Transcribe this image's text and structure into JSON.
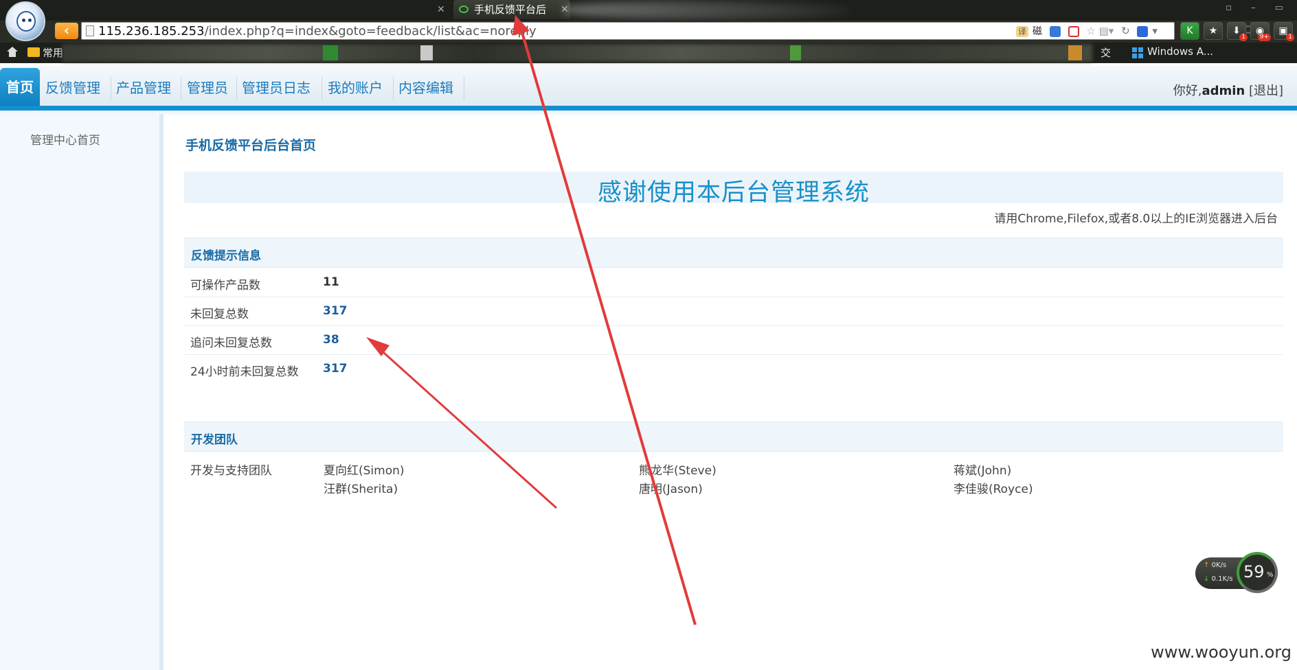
{
  "browser": {
    "tab_title": "手机反馈平台后",
    "url_host": "115.236.185.253",
    "url_path": "/index.php?q=index&goto=feedback/list&ac=noreply",
    "url_tools": [
      "译",
      "磁"
    ],
    "toolbar_badges": [
      "1",
      "9+",
      "1"
    ],
    "window_controls": "▫ – ▭",
    "bookmarks": {
      "common_folder": "常用",
      "jiao": "交",
      "windows": "Windows A..."
    },
    "colors": {
      "accent": "#f08a10",
      "chrome": "#1c1f1a"
    }
  },
  "nav": {
    "items": [
      "首页",
      "反馈管理",
      "产品管理",
      "管理员",
      "管理员日志",
      "我的账户",
      "内容编辑"
    ],
    "greeting_prefix": "你好,",
    "username": "admin",
    "logout": "[退出]",
    "colors": {
      "accent": "#1290cf",
      "link": "#1a7cbf"
    }
  },
  "sidebar": {
    "items": [
      "管理中心首页"
    ]
  },
  "main": {
    "page_title": "手机反馈平台后台首页",
    "banner_title": "感谢使用本后台管理系统",
    "browser_note": "请用Chrome,Filefox,或者8.0以上的IE浏览器进入后台",
    "feedback_section": {
      "title": "反馈提示信息",
      "rows": [
        {
          "label": "可操作产品数",
          "value": "11"
        },
        {
          "label": "未回复总数",
          "value": "317"
        },
        {
          "label": "追问未回复总数",
          "value": "38"
        },
        {
          "label": "24小时前未回复总数",
          "value": "317"
        }
      ]
    },
    "team_section": {
      "title": "开发团队",
      "label": "开发与支持团队",
      "members": [
        [
          "夏向红(Simon)",
          "熊龙华(Steve)",
          "蒋斌(John)"
        ],
        [
          "汪群(Sherita)",
          "唐明(Jason)",
          "李佳骏(Royce)"
        ]
      ]
    }
  },
  "net_monitor": {
    "up": "0K/s",
    "down": "0.1K/s",
    "percent": "59",
    "percent_sign": "%"
  },
  "watermark": "www.wooyun.org"
}
